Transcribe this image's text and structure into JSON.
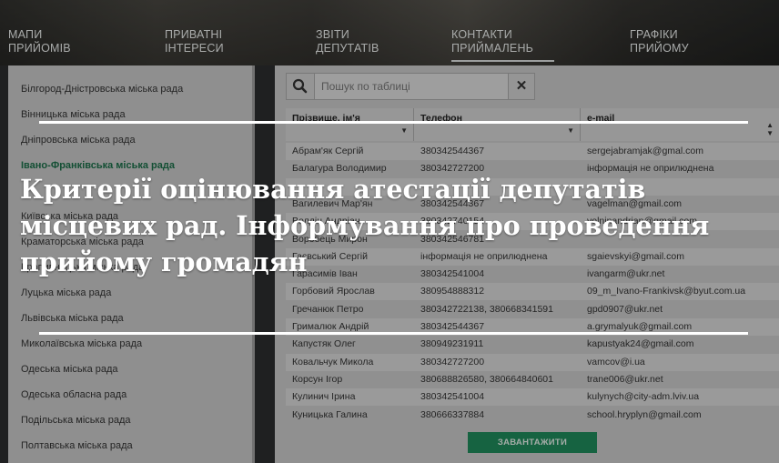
{
  "nav": [
    {
      "line1": "Мапи",
      "line2": "прийомів",
      "active": false
    },
    {
      "line1": "Приватні",
      "line2": "інтереси",
      "active": false
    },
    {
      "line1": "Звіти",
      "line2": "депутатів",
      "active": false
    },
    {
      "line1": "Контакти",
      "line2": "приймалень",
      "active": true
    },
    {
      "line1": "Графіки",
      "line2": "прийому",
      "active": false
    }
  ],
  "sidebar": {
    "items": [
      {
        "label": "Білгород-Дністровська міська рада"
      },
      {
        "label": "Вінницька міська рада"
      },
      {
        "label": "Дніпровська міська рада"
      },
      {
        "label": "Івано-Франківська міська рада",
        "active": true
      },
      {
        "label": "Київська міська рада"
      },
      {
        "label": "Краматорська міська рада"
      },
      {
        "label": "Кропивницька міська рада"
      },
      {
        "label": "Луцька міська рада"
      },
      {
        "label": "Львівська міська рада"
      },
      {
        "label": "Миколаївська міська рада"
      },
      {
        "label": "Одеська міська рада"
      },
      {
        "label": "Одеська обласна рада"
      },
      {
        "label": "Подільська міська рада"
      },
      {
        "label": "Полтавська міська рада"
      }
    ]
  },
  "search": {
    "placeholder": "Пошук по таблиці",
    "clear": "✕"
  },
  "table": {
    "columns": [
      "Прізвище, ім'я",
      "Телефон",
      "e-mail"
    ],
    "rows": [
      [
        "Абрам'як Сергій",
        "380342544367",
        "sergejabramjak@gmal.com"
      ],
      [
        "Балагура Володимир",
        "380342727200",
        "інформація не оприлюднена"
      ],
      [
        "",
        "",
        ""
      ],
      [
        "Вагилевич Мар'ян",
        "380342544367",
        "vagelman@gmail.com"
      ],
      [
        "Волдін Андріан",
        "380342740154",
        "volninandrian@gmail.com"
      ],
      [
        "Воробець Мирон",
        "380342546781",
        ""
      ],
      [
        "Гаєвський Сергій",
        "інформація не оприлюднена",
        "sgaievskyi@gmail.com"
      ],
      [
        "Гарасимів Іван",
        "380342541004",
        "ivangarm@ukr.net"
      ],
      [
        "Горбовий Ярослав",
        "380954888312",
        "09_m_Ivano-Frankivsk@byut.com.ua"
      ],
      [
        "Гречанюк Петро",
        "380342722138, 380668341591",
        "gpd0907@ukr.net"
      ],
      [
        "Грималюк Андрій",
        "380342544367",
        "a.grymalyuk@gmail.com"
      ],
      [
        "Капустяк Олег",
        "380949231911",
        "kapustyak24@gmail.com"
      ],
      [
        "Ковальчук Микола",
        "380342727200",
        "vamcov@i.ua"
      ],
      [
        "Корсун Ігор",
        "380688826580, 380664840601",
        "trane006@ukr.net"
      ],
      [
        "Кулинич Ірина",
        "380342541004",
        "kulynych@city-adm.lviv.ua"
      ],
      [
        "Куницька Галина",
        "380666337884",
        "school.hryplyn@gmail.com"
      ]
    ]
  },
  "download_label": "Завантажити",
  "banner": {
    "title": "Критерії оцінювання атестації депутатів місцевих рад. Інформування про проведення прийому громадян"
  },
  "colors": {
    "accent": "#1f8a5a",
    "active_link": "#1b6e48"
  }
}
